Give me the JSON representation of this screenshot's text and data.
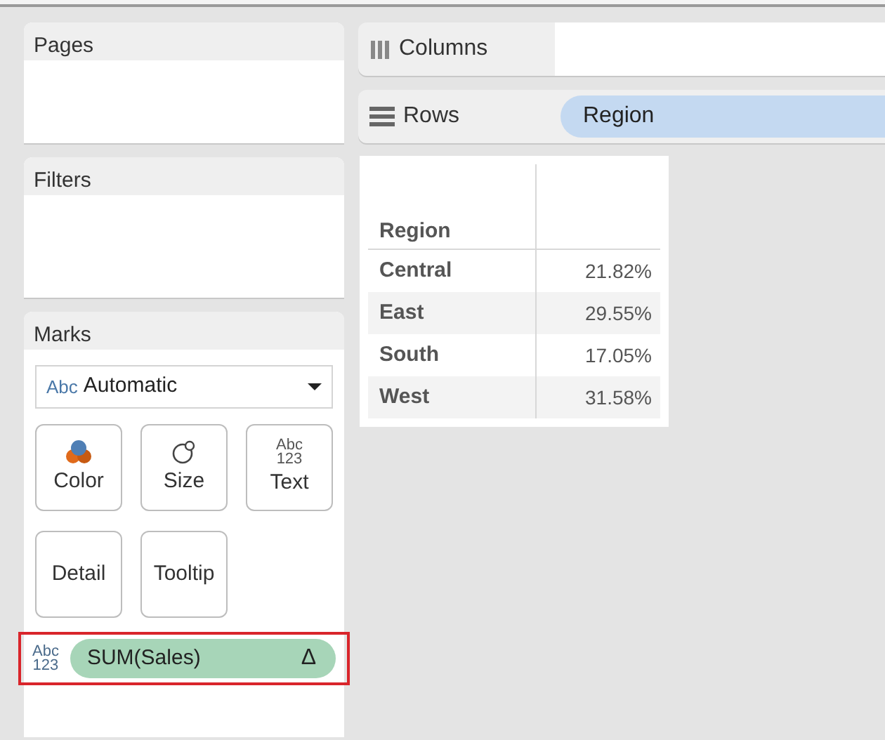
{
  "cards": [
    {
      "title": "Pages"
    },
    {
      "title": "Filters"
    }
  ],
  "marks": {
    "title": "Marks",
    "mark_type": {
      "icon_text": "Abc",
      "value": "Automatic"
    },
    "buttons": [
      {
        "kind": "color",
        "label": "Color"
      },
      {
        "kind": "size",
        "label": "Size"
      },
      {
        "kind": "text",
        "label": "Text",
        "icon_lines": [
          "Abc",
          "123"
        ]
      },
      {
        "kind": "plain",
        "label": "Detail"
      },
      {
        "kind": "plain",
        "label": "Tooltip"
      }
    ],
    "fields": [
      {
        "type_lines": [
          "Abc",
          "123"
        ],
        "label": "SUM(Sales)",
        "delta": "Δ",
        "highlighted": true
      }
    ]
  },
  "shelves": [
    {
      "kind": "columns",
      "label": "Columns"
    },
    {
      "kind": "rows",
      "label": "Rows",
      "pills": [
        "Region"
      ]
    }
  ],
  "table": {
    "columns": [
      "Region"
    ],
    "rows": [
      {
        "region": "Central",
        "value": "21.82%"
      },
      {
        "region": "East",
        "value": "29.55%"
      },
      {
        "region": "South",
        "value": "17.05%"
      },
      {
        "region": "West",
        "value": "31.58%"
      }
    ]
  }
}
